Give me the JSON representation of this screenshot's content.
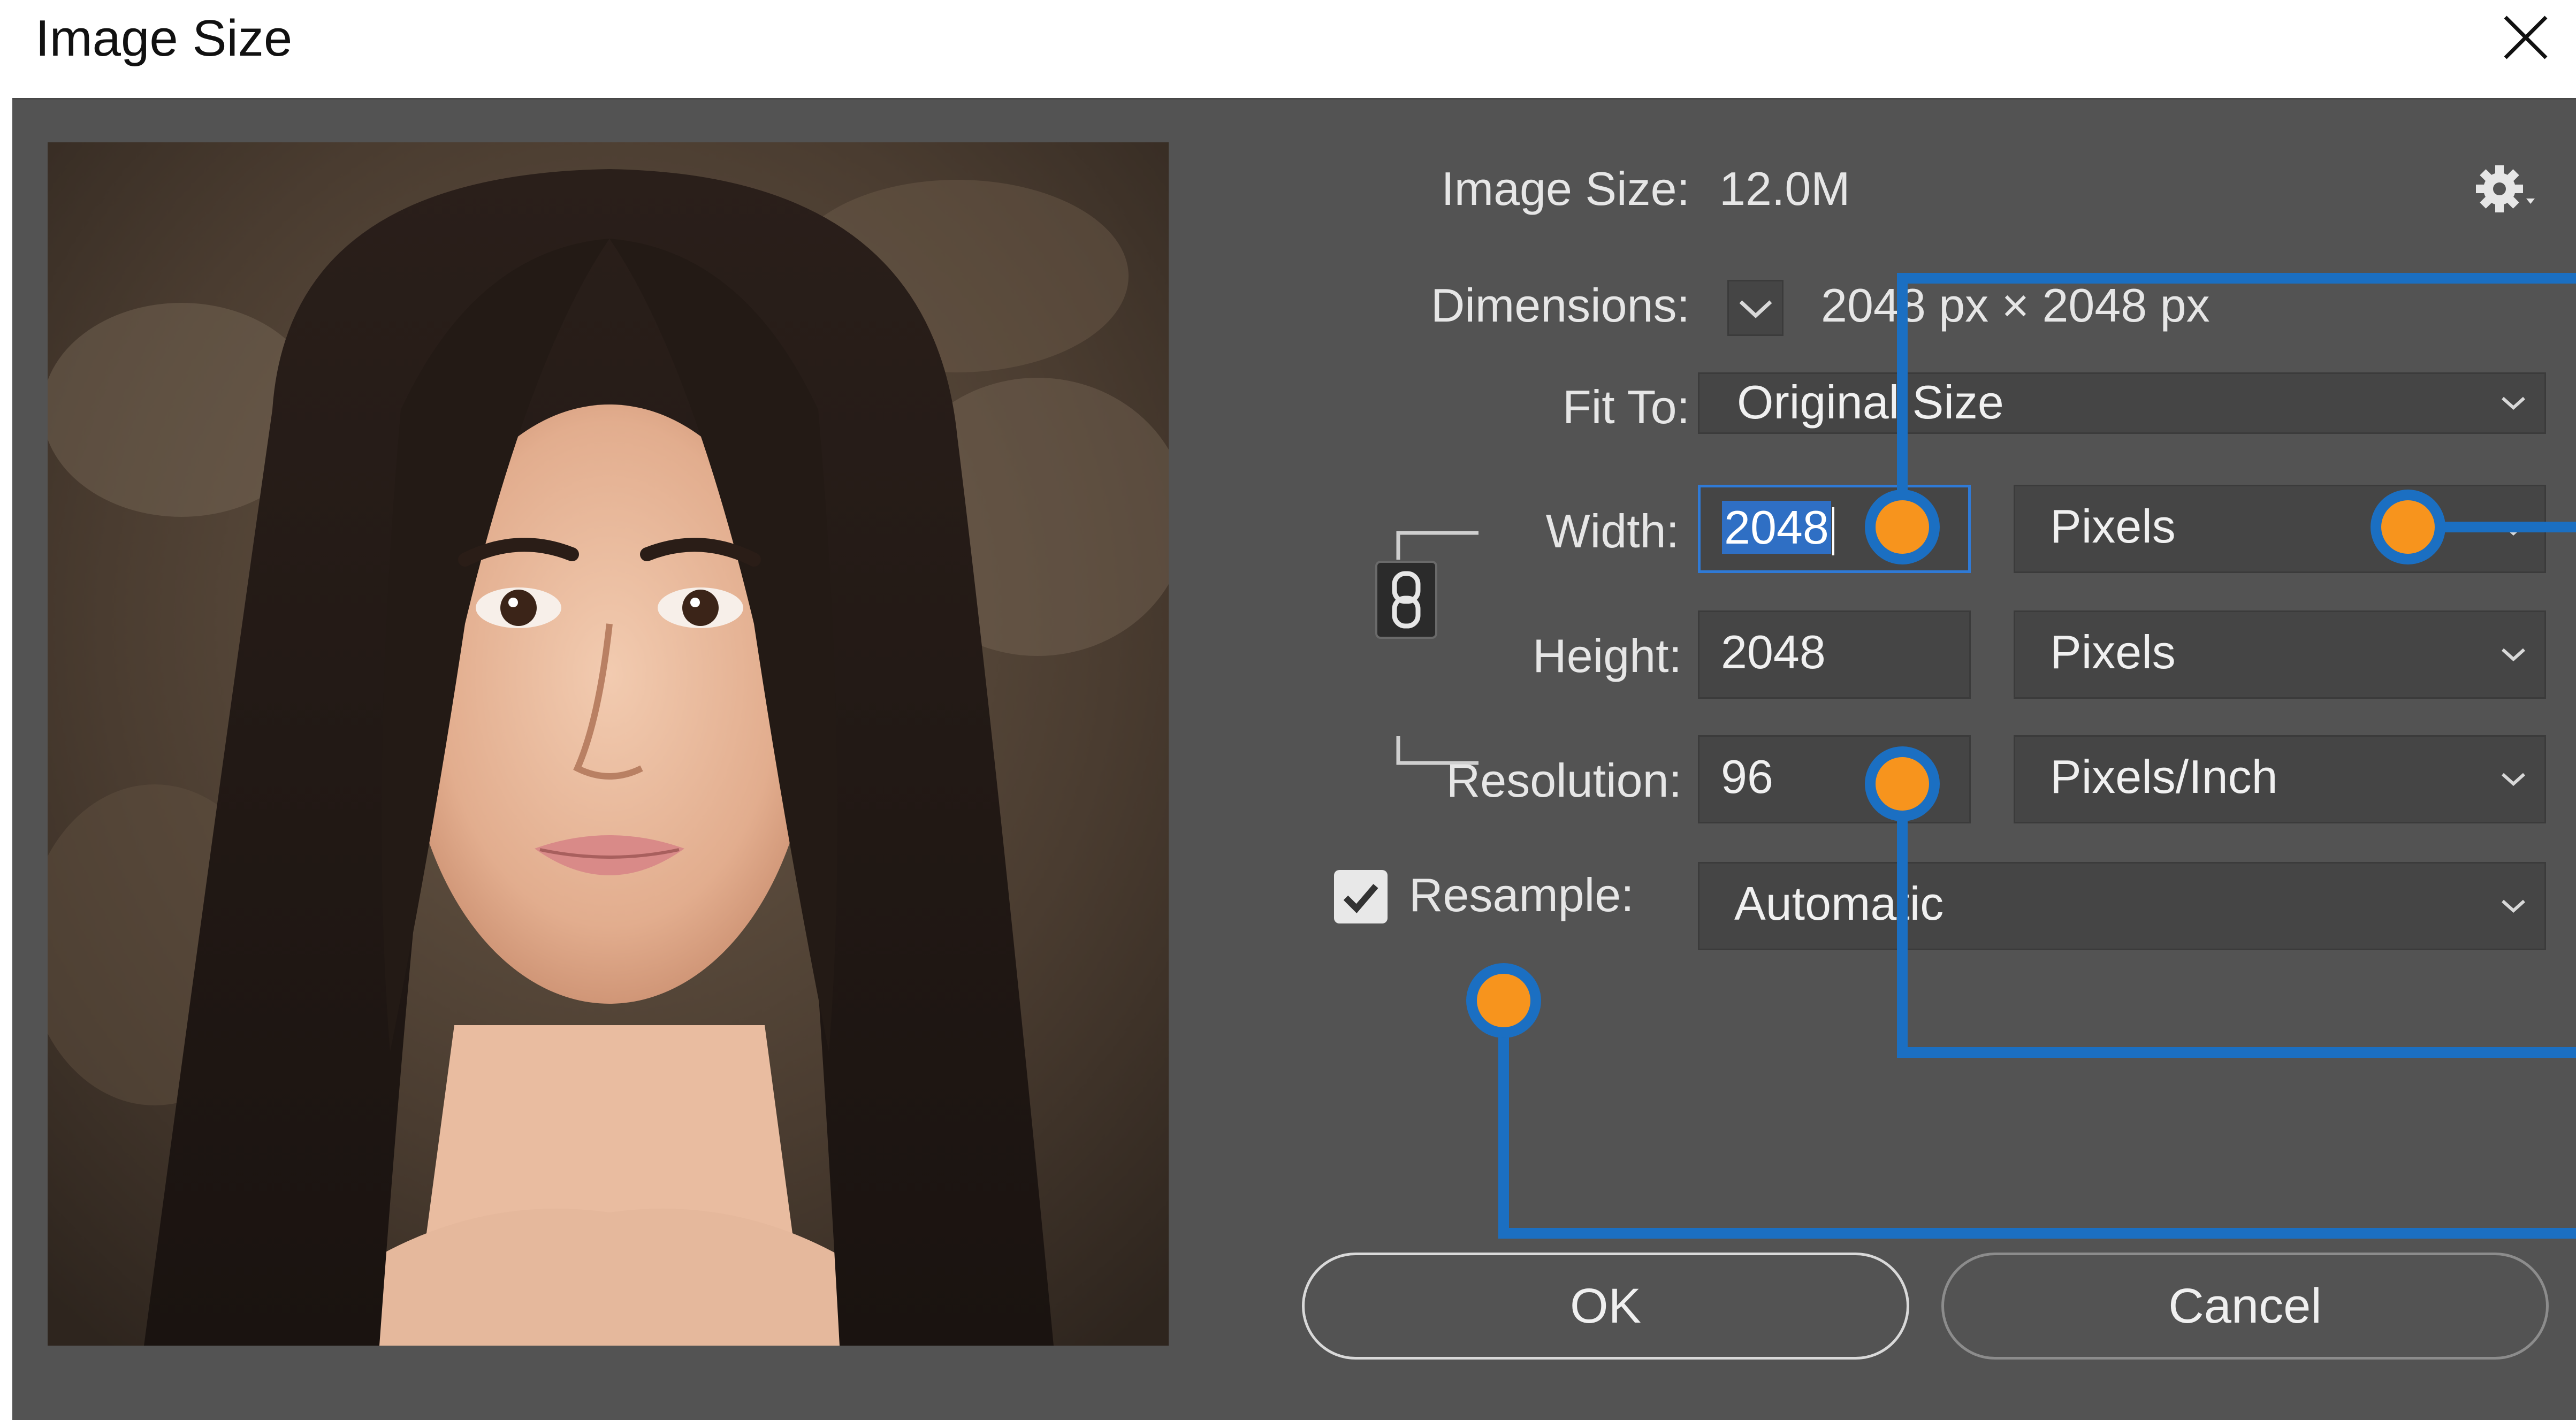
{
  "window": {
    "title": "Image Size"
  },
  "info": {
    "image_size_label": "Image Size:",
    "image_size_value": "12.0M",
    "dimensions_label": "Dimensions:",
    "dimensions_value": "2048 px  ×  2048 px"
  },
  "fit_to": {
    "label": "Fit To:",
    "value": "Original Size"
  },
  "width": {
    "label": "Width:",
    "value": "2048",
    "unit": "Pixels"
  },
  "height": {
    "label": "Height:",
    "value": "2048",
    "unit": "Pixels"
  },
  "resolution": {
    "label": "Resolution:",
    "value": "96",
    "unit": "Pixels/Inch"
  },
  "resample": {
    "label": "Resample:",
    "checked": true,
    "value": "Automatic"
  },
  "buttons": {
    "ok": "OK",
    "cancel": "Cancel"
  },
  "icons": {
    "close": "close-icon",
    "gear": "gear-icon",
    "link": "link-icon",
    "check": "checkmark-icon",
    "chevron": "chevron-down-icon"
  },
  "colors": {
    "panel": "#535353",
    "field": "#454545",
    "callout_line": "#1b6fc2",
    "callout_dot": "#f7941d",
    "selection": "#2f6fc4"
  }
}
